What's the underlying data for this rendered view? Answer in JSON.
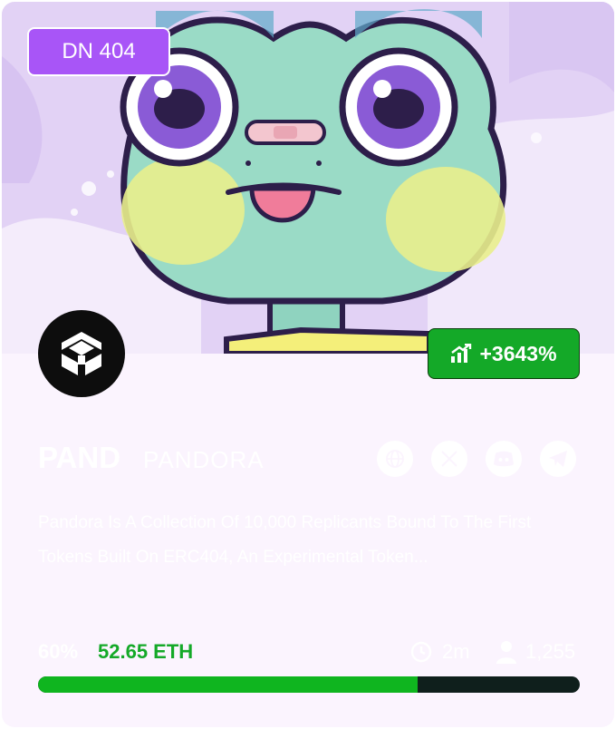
{
  "card": {
    "badge": "DN 404",
    "change": "+3643%",
    "ticker": "PAND",
    "name": "PANDORA",
    "description": "Pandora Is A Collection Of 10,000 Replicants Bound To The First Tokens Built On ERC404, An Experimental Token...",
    "progress_percent_label": "60%",
    "progress_fraction": 0.7,
    "raised": "52.65 ETH",
    "age": "2m",
    "holders": "1,255",
    "socials": [
      {
        "icon": "globe-icon"
      },
      {
        "icon": "x-twitter-icon"
      },
      {
        "icon": "discord-icon"
      },
      {
        "icon": "telegram-icon"
      }
    ],
    "colors": {
      "accent_purple": "#a855f7",
      "positive_green": "#14a928",
      "progress_track": "#0f1f1c",
      "card_bg": "#fbf4fe"
    }
  }
}
